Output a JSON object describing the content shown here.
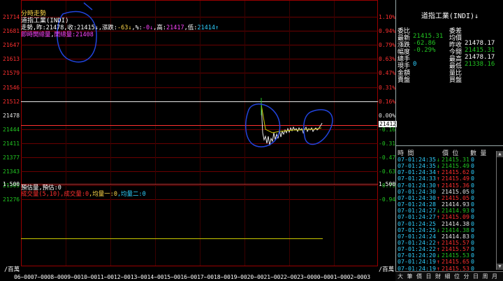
{
  "header": {
    "title": "分時走勢",
    "symbol": "道指工業(INDI)",
    "stats_prefix": "走勢,昨:",
    "prev_close": "21478",
    "stats_mid": ",收:",
    "close": "21415↓",
    "change_label": ",漲跌:",
    "change": "-63↓",
    "pct_label": ",%:",
    "pct": "-0↓",
    "high_label": ",高:",
    "high": "21417",
    "low_label": ",低:",
    "low": "21414↑",
    "line2_a": "即時開總量",
    "line2_sep": ",",
    "line2_b": "開總量:21408"
  },
  "y_axis_left": [
    "21714",
    "21681",
    "21647",
    "21613",
    "21579",
    "21546",
    "21512",
    "21478",
    "21444",
    "21411",
    "21377",
    "21343",
    "21309",
    "21276"
  ],
  "y_axis_right": [
    "1.10%",
    "0.94%",
    "0.79%",
    "0.63%",
    "0.47%",
    "0.31%",
    "0.16%",
    "0.00%",
    "-0.16",
    "-0.31",
    "-0.47",
    "-0.63",
    "-0.79",
    "-0.94"
  ],
  "price_tag": "21412",
  "volume_panel": {
    "scale_left": "1.500",
    "scale_right": "1.500",
    "title": "預估量,預估:0",
    "indicator_a": "成交量(5,10)",
    "indicator_b": ",成交量:0",
    "indicator_c": ",均量一:0",
    "indicator_d": ",均量二:0",
    "unit_left": "/百萬",
    "unit_right": "/百萬"
  },
  "x_axis_times": "06~0007~0008~0009~0010~0011~0012~0013~0014~0015~0016~0017~0018~0019~0020~0021~0022~0023~0000~0001~0002~0003~0004~00",
  "quote": {
    "title": "道指工業(INDI)↓",
    "rows": [
      {
        "l1": "委比",
        "v1": "",
        "l2": "委差",
        "v2": ""
      },
      {
        "l1": "最新",
        "v1": "21415.31",
        "l2": "均價",
        "v2": ""
      },
      {
        "l1": "漲跌",
        "v1": "-62.86",
        "l2": "昨收",
        "v2": "21478.17"
      },
      {
        "l1": "幅度",
        "v1": "-0.29%",
        "l2": "今開",
        "v2": "21415.31"
      },
      {
        "l1": "總手",
        "v1": "",
        "l2": "最高",
        "v2": "21478.17"
      },
      {
        "l1": "現手",
        "v1": "0",
        "l2": "最低",
        "v2": "21338.16"
      },
      {
        "l1": "金額",
        "v1": "",
        "l2": "量比",
        "v2": ""
      },
      {
        "l1": "賣盤",
        "v1": "",
        "l2": "買盤",
        "v2": ""
      }
    ]
  },
  "ticks": {
    "headers": {
      "time": "時 間",
      "price": "價 位",
      "vol": "數 量"
    },
    "rows": [
      {
        "time": "07-01:24:35",
        "dir": "↓",
        "price": "21415.31",
        "vol": "0",
        "cls": "dn"
      },
      {
        "time": "07-01:24:35",
        "dir": "↓",
        "price": "21415.49",
        "vol": "0",
        "cls": "dn"
      },
      {
        "time": "07-01:24:34",
        "dir": "↑",
        "price": "21415.62",
        "vol": "0",
        "cls": "up"
      },
      {
        "time": "07-01:24:33",
        "dir": "↑",
        "price": "21415.49",
        "vol": "0",
        "cls": "up"
      },
      {
        "time": "07-01:24:30",
        "dir": "↑",
        "price": "21415.36",
        "vol": "0",
        "cls": "up"
      },
      {
        "time": "07-01:24:30",
        "dir": "",
        "price": "21415.05",
        "vol": "0",
        "cls": "fl"
      },
      {
        "time": "07-01:24:30",
        "dir": "↑",
        "price": "21415.05",
        "vol": "0",
        "cls": "up"
      },
      {
        "time": "07-01:24:28",
        "dir": "",
        "price": "21414.93",
        "vol": "0",
        "cls": "fl"
      },
      {
        "time": "07-01:24:27",
        "dir": "↓",
        "price": "21414.93",
        "vol": "0",
        "cls": "dn"
      },
      {
        "time": "07-01:24:27",
        "dir": "↑",
        "price": "21415.09",
        "vol": "0",
        "cls": "up"
      },
      {
        "time": "07-01:24:25",
        "dir": "",
        "price": "21414.38",
        "vol": "0",
        "cls": "fl"
      },
      {
        "time": "07-01:24:25",
        "dir": "↓",
        "price": "21414.38",
        "vol": "0",
        "cls": "dn"
      },
      {
        "time": "07-01:24:24",
        "dir": "",
        "price": "21414.83",
        "vol": "0",
        "cls": "fl"
      },
      {
        "time": "07-01:24:22",
        "dir": "↑",
        "price": "21415.57",
        "vol": "0",
        "cls": "up"
      },
      {
        "time": "07-01:24:22",
        "dir": "↑",
        "price": "21415.57",
        "vol": "0",
        "cls": "up"
      },
      {
        "time": "07-01:24:20",
        "dir": "↓",
        "price": "21415.53",
        "vol": "0",
        "cls": "dn"
      },
      {
        "time": "07-01:24:19",
        "dir": "↑",
        "price": "21415.65",
        "vol": "0",
        "cls": "up"
      },
      {
        "time": "07-01:24:19",
        "dir": "↑",
        "price": "21415.53",
        "vol": "0",
        "cls": "up"
      },
      {
        "time": "07-01:24:18",
        "dir": "↓",
        "price": "21415.54",
        "vol": "0",
        "cls": "dn"
      }
    ]
  },
  "tabs": [
    "大",
    "筆",
    "價",
    "日",
    "財",
    "細",
    "位",
    "分",
    "日",
    "周",
    "月"
  ],
  "colors": {
    "up": "#ff3030",
    "down": "#22c522",
    "ref": "#2fd0ff",
    "grid": "#7a0000",
    "annotation": "#2244dd"
  }
}
